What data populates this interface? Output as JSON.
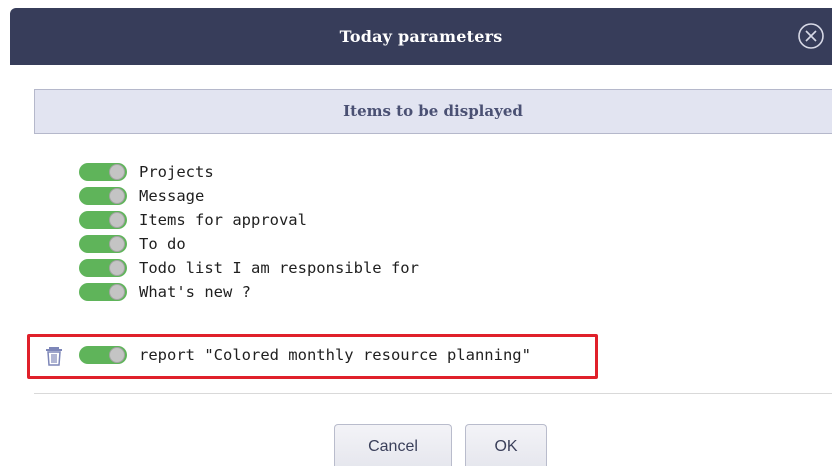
{
  "dialog": {
    "title": "Today parameters",
    "close_icon": "close-circle-icon"
  },
  "section": {
    "header": "Items to be displayed"
  },
  "items": [
    {
      "label": "Projects",
      "enabled": true
    },
    {
      "label": "Message",
      "enabled": true
    },
    {
      "label": "Items for approval",
      "enabled": true
    },
    {
      "label": "To do",
      "enabled": true
    },
    {
      "label": "Todo list I am responsible for",
      "enabled": true
    },
    {
      "label": "What's new ?",
      "enabled": true
    },
    {
      "label": "report \"Colored monthly resource planning\"",
      "enabled": true,
      "deletable": true,
      "highlighted": true
    }
  ],
  "buttons": {
    "cancel": "Cancel",
    "ok": "OK"
  },
  "colors": {
    "title_bar": "#373d5a",
    "section_header_bg": "#e2e4f1",
    "toggle_on": "#5fb45a",
    "highlight": "#e0202a"
  }
}
